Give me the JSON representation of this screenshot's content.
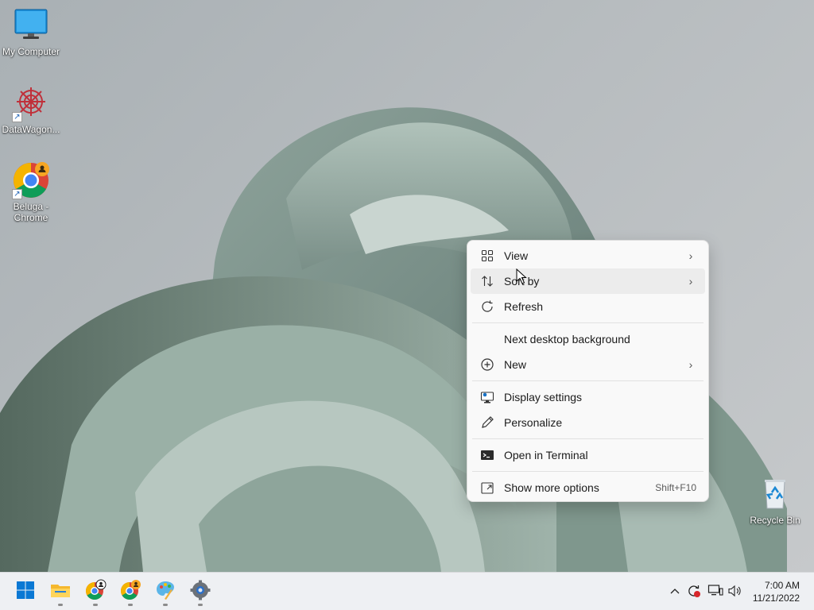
{
  "desktop": {
    "icons": [
      {
        "label": "My Computer",
        "icon": "monitor-icon"
      },
      {
        "label": "DataWagon...",
        "icon": "datawagon-icon"
      },
      {
        "label": "Beluga -\nChrome",
        "label_line1": "Beluga -",
        "label_line2": "Chrome",
        "icon": "chrome-profile-icon"
      },
      {
        "label": "Recycle Bin",
        "icon": "recycle-bin-icon"
      }
    ]
  },
  "context_menu": {
    "items": [
      {
        "label": "View",
        "icon": "grid-icon",
        "submenu": true
      },
      {
        "label": "Sort by",
        "icon": "sort-icon",
        "submenu": true,
        "hovered": true
      },
      {
        "label": "Refresh",
        "icon": "refresh-icon"
      },
      {
        "label": "Next desktop background"
      },
      {
        "label": "New",
        "icon": "plus-circle-icon",
        "submenu": true
      },
      {
        "label": "Display settings",
        "icon": "display-settings-icon"
      },
      {
        "label": "Personalize",
        "icon": "pen-icon"
      },
      {
        "label": "Open in Terminal",
        "icon": "terminal-icon"
      },
      {
        "label": "Show more options",
        "icon": "share-icon",
        "shortcut": "Shift+F10"
      }
    ]
  },
  "taskbar": {
    "apps": [
      {
        "name": "start",
        "icon": "windows-logo-icon"
      },
      {
        "name": "file-explorer",
        "icon": "folder-icon"
      },
      {
        "name": "chrome-profile-1",
        "icon": "chrome-profile-icon"
      },
      {
        "name": "chrome-profile-2",
        "icon": "chrome-profile-icon"
      },
      {
        "name": "paint",
        "icon": "palette-icon"
      },
      {
        "name": "settings",
        "icon": "gear-icon"
      }
    ],
    "clock": {
      "time": "7:00 AM",
      "date": "11/21/2022"
    }
  },
  "colors": {
    "accent": "#0067c0",
    "menu_bg": "#f9f9f9",
    "taskbar_bg": "#eef0f3"
  }
}
